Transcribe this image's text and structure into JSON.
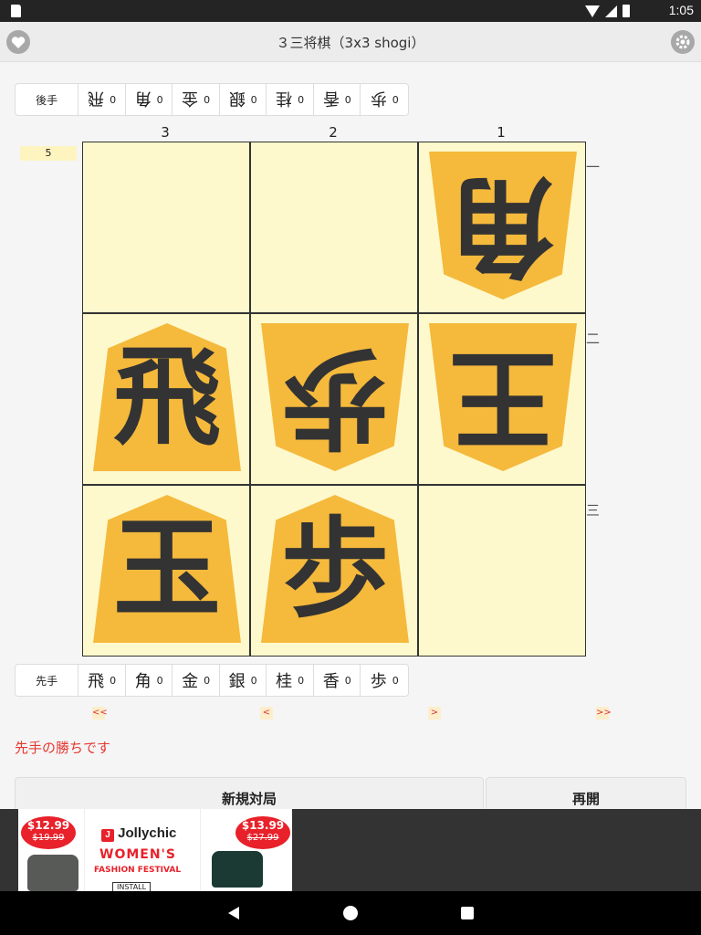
{
  "status_bar": {
    "time": "1:05"
  },
  "app_bar": {
    "title": "３三将棋（3x3 shogi）",
    "left_icon": "heart-icon",
    "right_icon": "gear-icon"
  },
  "gote_hand": {
    "label": "後手",
    "pieces": [
      {
        "piece": "飛",
        "count": "0"
      },
      {
        "piece": "角",
        "count": "0"
      },
      {
        "piece": "金",
        "count": "0"
      },
      {
        "piece": "銀",
        "count": "0"
      },
      {
        "piece": "桂",
        "count": "0"
      },
      {
        "piece": "香",
        "count": "0"
      },
      {
        "piece": "歩",
        "count": "0"
      }
    ]
  },
  "sente_hand": {
    "label": "先手",
    "pieces": [
      {
        "piece": "飛",
        "count": "0"
      },
      {
        "piece": "角",
        "count": "0"
      },
      {
        "piece": "金",
        "count": "0"
      },
      {
        "piece": "銀",
        "count": "0"
      },
      {
        "piece": "桂",
        "count": "0"
      },
      {
        "piece": "香",
        "count": "0"
      },
      {
        "piece": "歩",
        "count": "0"
      }
    ]
  },
  "move_counter": "5",
  "board": {
    "files": [
      "3",
      "2",
      "1"
    ],
    "ranks": [
      "一",
      "二",
      "三"
    ],
    "pieces": [
      {
        "file": "1",
        "rank": "一",
        "kanji": "角",
        "owner": "gote"
      },
      {
        "file": "3",
        "rank": "二",
        "kanji": "飛",
        "owner": "sente"
      },
      {
        "file": "2",
        "rank": "二",
        "kanji": "歩",
        "owner": "gote"
      },
      {
        "file": "1",
        "rank": "二",
        "kanji": "王",
        "owner": "gote"
      },
      {
        "file": "3",
        "rank": "三",
        "kanji": "玉",
        "owner": "sente"
      },
      {
        "file": "2",
        "rank": "三",
        "kanji": "歩",
        "owner": "sente"
      }
    ]
  },
  "nav": {
    "first": "<<",
    "prev": "<",
    "next": ">",
    "last": ">>"
  },
  "message": "先手の勝ちです",
  "buttons": {
    "new_game": "新規対局",
    "resume": "再開"
  },
  "ad": {
    "brand": "Jollychic",
    "headline": "WOMEN'S",
    "sub": "FASHION FESTIVAL",
    "install": "INSTALL",
    "price_left": "$12.99",
    "old_left": "$19.99",
    "price_right": "$13.99",
    "old_right": "$27.99"
  },
  "colors": {
    "board": "#fef9cc",
    "piece": "#f5b93c",
    "message": "#e53935"
  }
}
